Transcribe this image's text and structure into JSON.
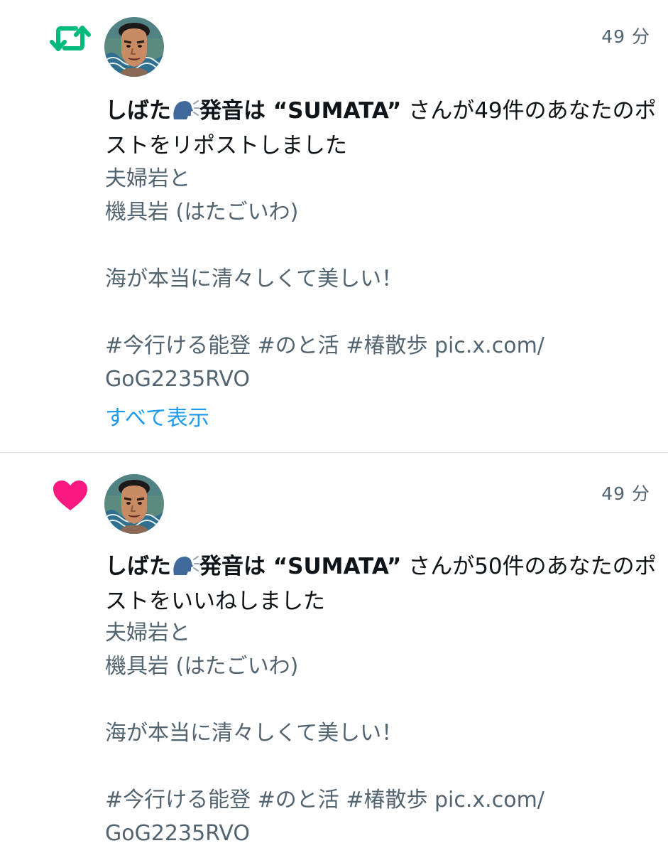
{
  "notifications": [
    {
      "type": "repost",
      "icon": "repost-icon",
      "icon_color": "#00ba7c",
      "time": "49 分",
      "user_name": "しばた",
      "user_name_suffix": "発音は “SUMATA”",
      "action_text": " さんが49件のあなたのポストをリポストしました",
      "post_lines": [
        "夫婦岩と",
        "機具岩 (はたごいわ)",
        "",
        "海が本当に清々しくて美しい！",
        "",
        " #今行ける能登  #のと活  #椿散歩 pic.x.com/",
        "GoG2235RVO"
      ],
      "show_all": "すべて表示"
    },
    {
      "type": "like",
      "icon": "heart-icon",
      "icon_color": "#f91880",
      "time": "49 分",
      "user_name": "しばた",
      "user_name_suffix": "発音は “SUMATA”",
      "action_text": " さんが50件のあなたのポストをいいねしました",
      "post_lines": [
        "夫婦岩と",
        "機具岩 (はたごいわ)",
        "",
        "海が本当に清々しくて美しい！",
        "",
        " #今行ける能登  #のと活  #椿散歩 pic.x.com/",
        "GoG2235RVO"
      ]
    }
  ]
}
